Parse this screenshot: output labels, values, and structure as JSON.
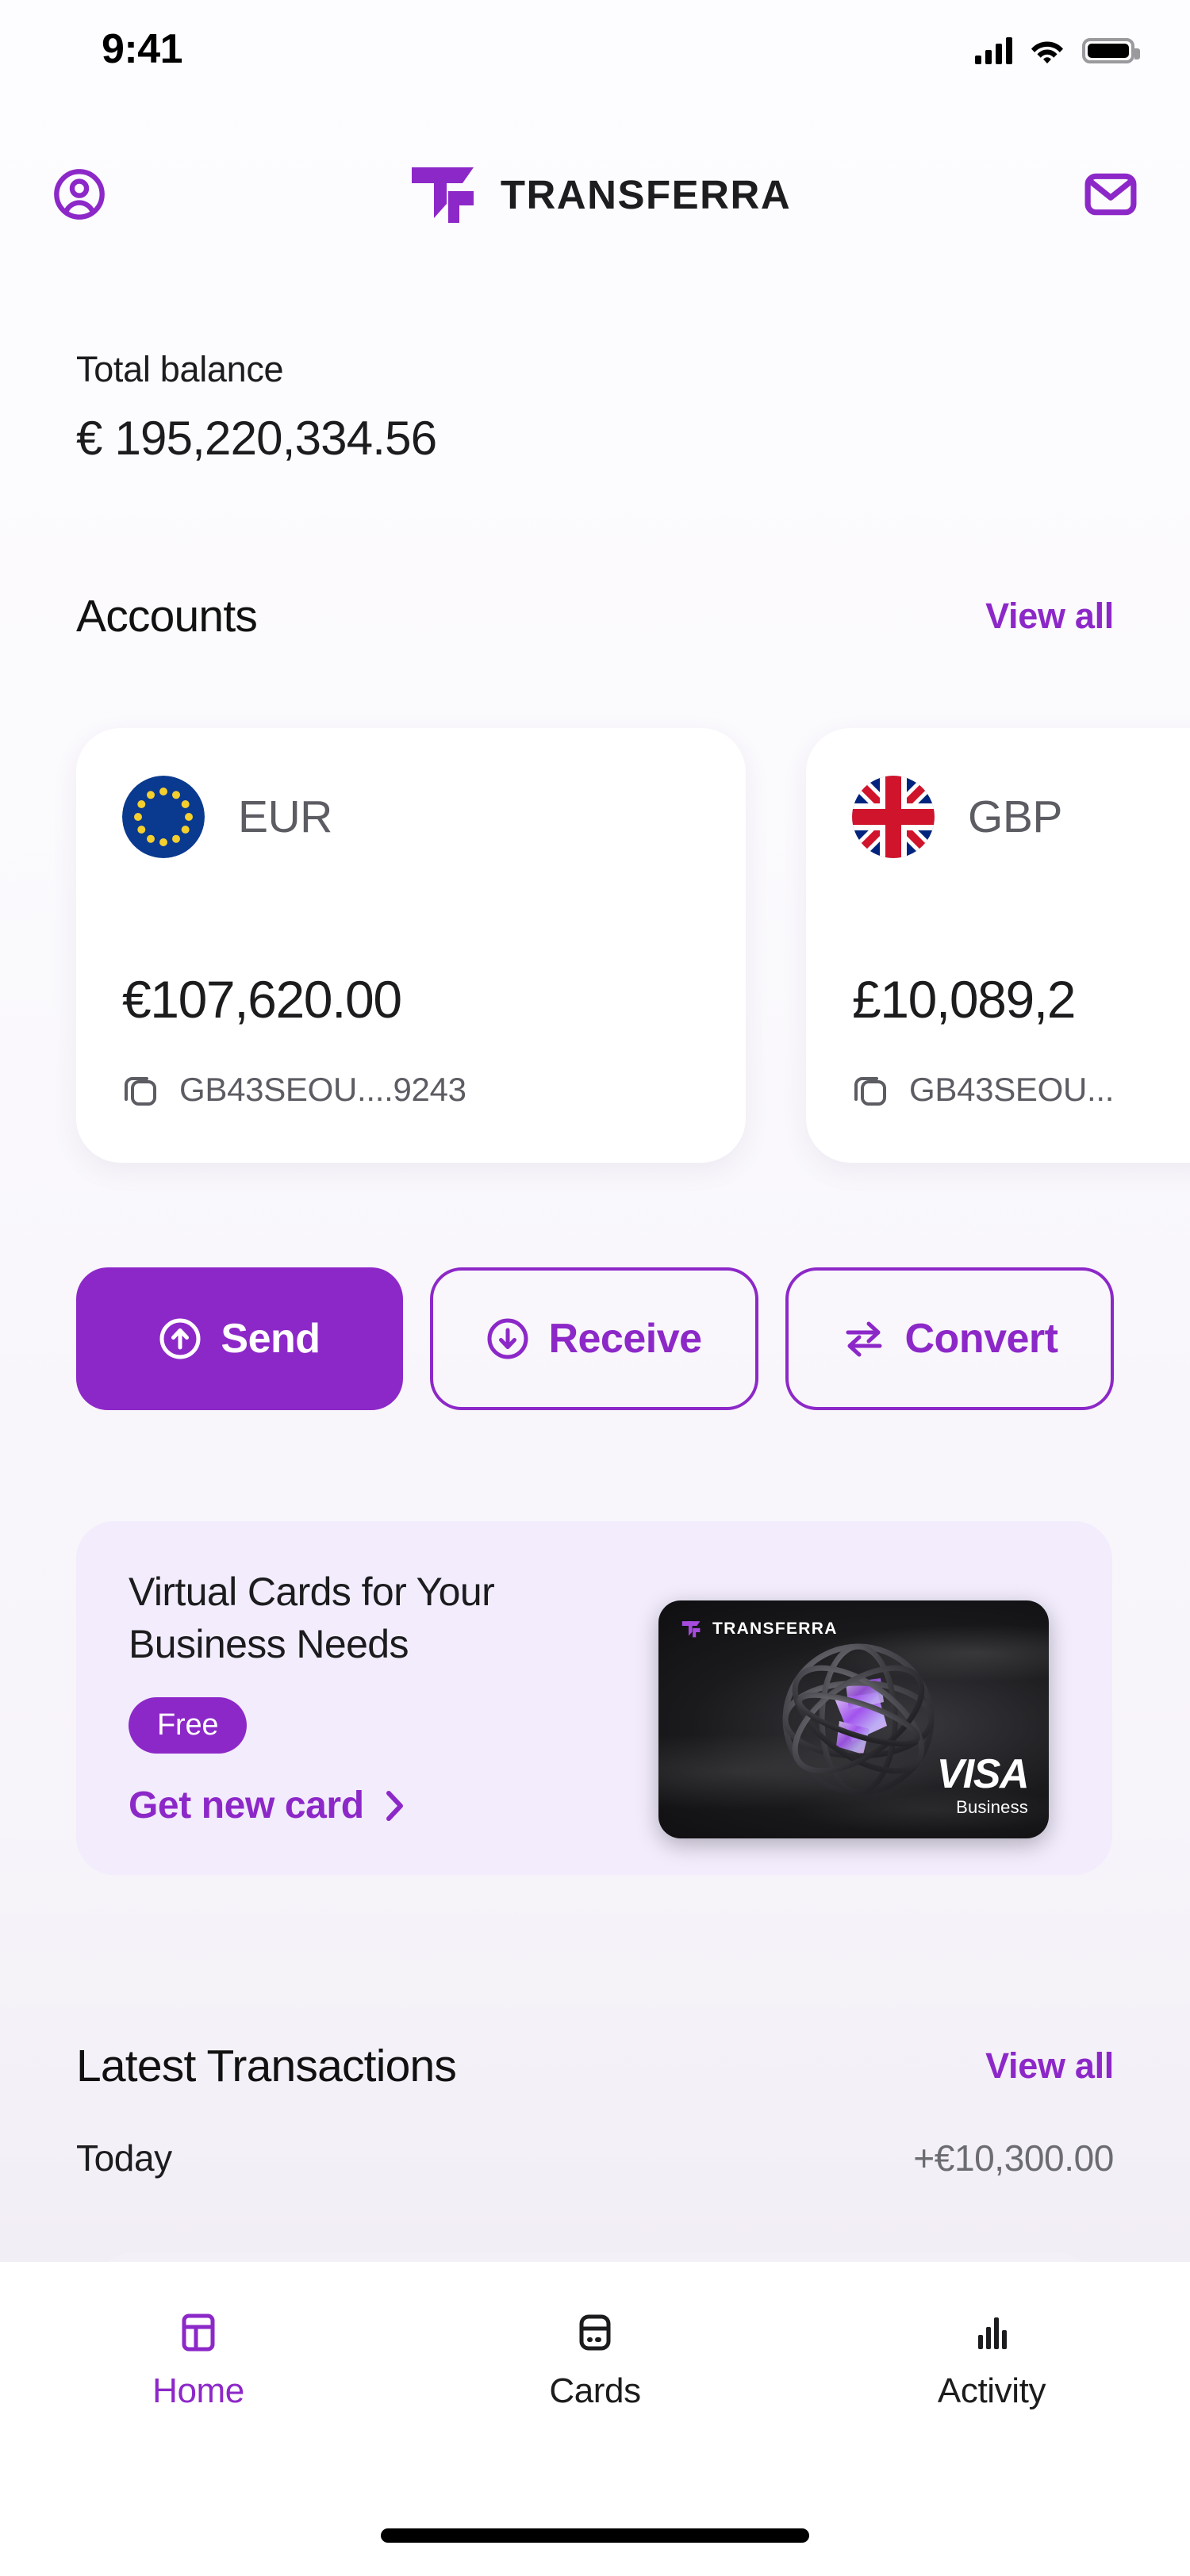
{
  "status_bar": {
    "time": "9:41",
    "signal_icon": "cellular-signal-icon",
    "wifi_icon": "wifi-icon",
    "battery_icon": "battery-full-icon"
  },
  "app_bar": {
    "profile_icon": "account-circle-icon",
    "brand_name": "TRANSFERRA",
    "logo_icon": "transferra-logo-icon",
    "mail_icon": "mail-icon"
  },
  "balance": {
    "label": "Total balance",
    "value": "€ 195,220,334.56"
  },
  "accounts_section": {
    "title": "Accounts",
    "view_all": "View all",
    "cards": [
      {
        "currency": "EUR",
        "flag_icon": "eu-flag-icon",
        "amount": "€107,620.00",
        "iban": "GB43SEOU....9243",
        "copy_icon": "copy-icon"
      },
      {
        "currency": "GBP",
        "flag_icon": "uk-flag-icon",
        "amount": "£10,089,2",
        "iban": "GB43SEOU...",
        "copy_icon": "copy-icon"
      }
    ]
  },
  "actions": [
    {
      "label": "Send",
      "icon": "arrow-up-circle-icon",
      "style": "primary"
    },
    {
      "label": "Receive",
      "icon": "arrow-down-circle-icon",
      "style": "ghost"
    },
    {
      "label": "Convert",
      "icon": "swap-arrows-icon",
      "style": "ghost"
    }
  ],
  "promo": {
    "title": "Virtual Cards for Your Business Needs",
    "badge": "Free",
    "cta": "Get new card",
    "cta_icon": "chevron-right-icon",
    "card": {
      "brand": "TRANSFERRA",
      "network": "VISA",
      "tier": "Business",
      "art_icon": "orb-sphere-icon"
    }
  },
  "transactions_section": {
    "title": "Latest Transactions",
    "view_all": "View all",
    "groups": [
      {
        "day": "Today",
        "total": "+€10,300.00"
      }
    ]
  },
  "tab_bar": {
    "items": [
      {
        "label": "Home",
        "icon": "dashboard-icon",
        "active": true
      },
      {
        "label": "Cards",
        "icon": "card-icon",
        "active": false
      },
      {
        "label": "Activity",
        "icon": "bar-chart-icon",
        "active": false
      }
    ]
  },
  "theme": {
    "accent": "#8D28C8",
    "promo_bg": "#f2ecfd",
    "text": "#1c1c1e",
    "muted": "#5c5c63"
  }
}
